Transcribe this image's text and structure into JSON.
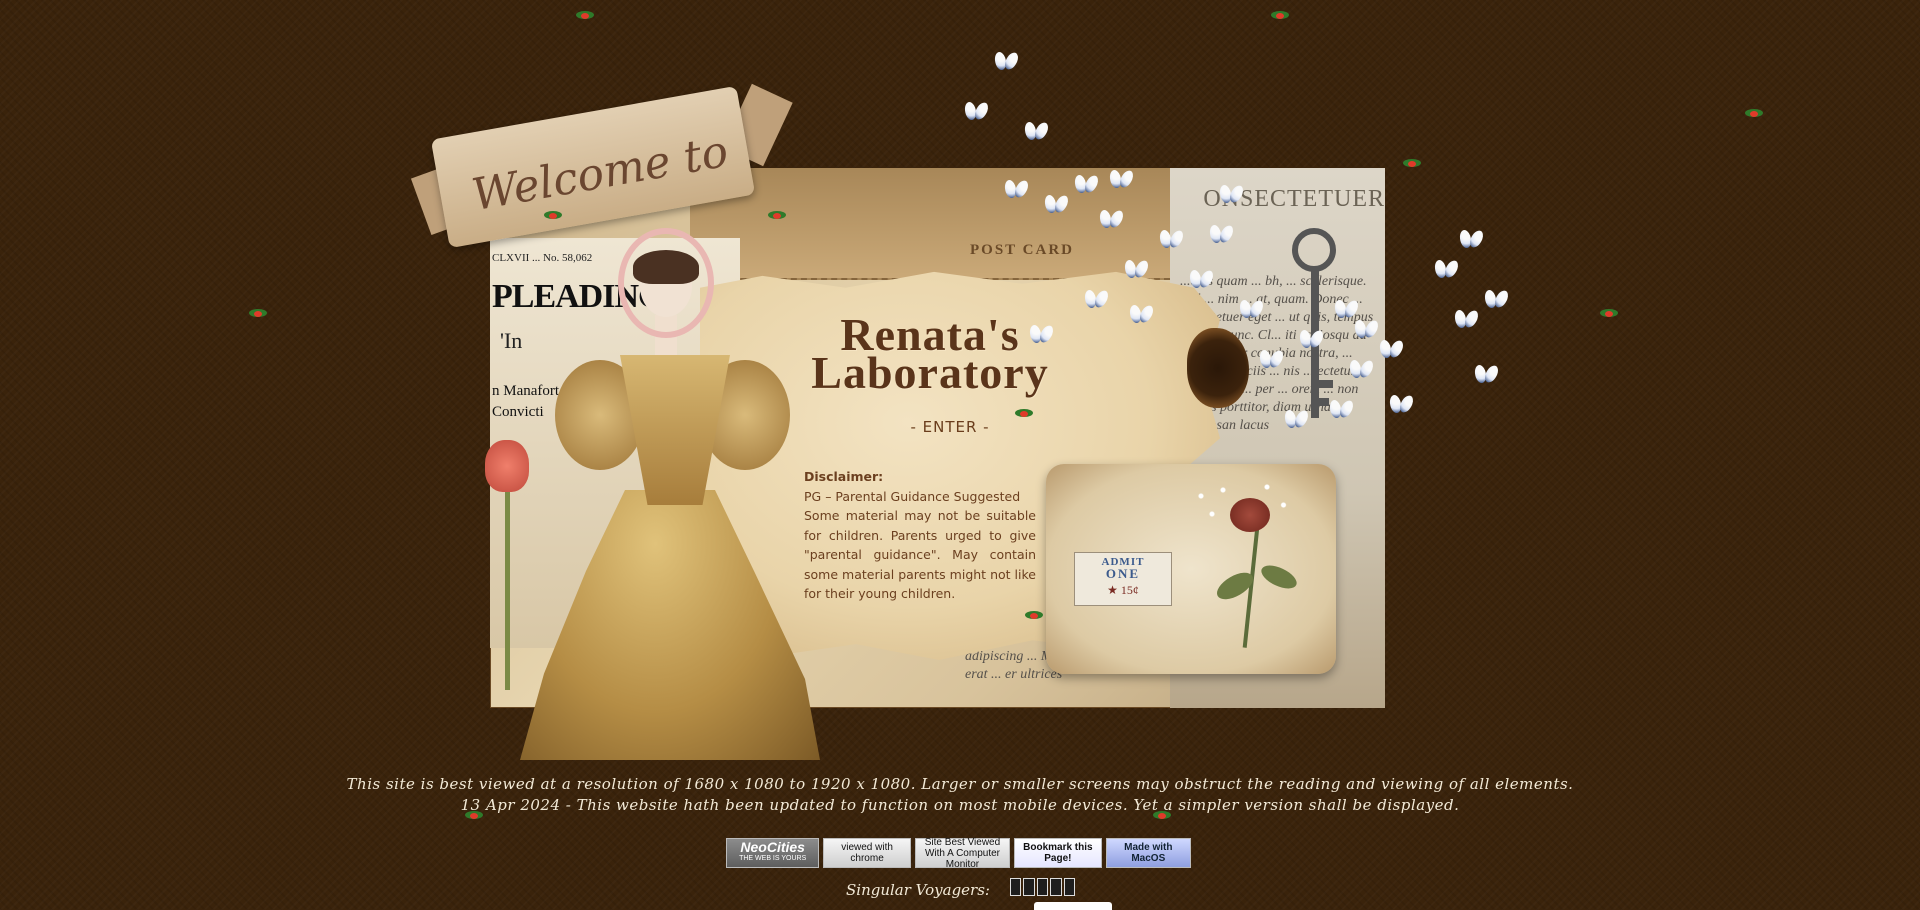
{
  "banner": {
    "text": "Welcome to"
  },
  "newspaper": {
    "masthead": "CLXVII ... No. 58,062",
    "headline": "PLEADING",
    "sub1": "'In",
    "sub2": "n Manafort T",
    "sub3": "Convicti"
  },
  "postcard": {
    "label": "POST CARD"
  },
  "right_column": {
    "heading": "ONSECTETUER",
    "text": "...etus quam ... bh, ... scelerisque. Sed ... nim ... at, quam. Donec ... onsectetuer eget ... ut quis, tempus ... In in nunc. Cl... iti sociosqu ad litora ... per conubia nostra, ... Donec ... sociis ... nis ... ectetur ... ous ... iam ... per ... orem ... non cursus porttitor, diam urna accumsan lacus"
  },
  "bottom_text": "adipiscing ... Morbi neque. Aliquam erat ... er ultrices",
  "site": {
    "title_line1": "Renata's",
    "title_line2": "Laboratory",
    "enter": "- ENTER -"
  },
  "disclaimer": {
    "title": "Disclaimer:",
    "rating": "PG – Parental Guidance Suggested",
    "body": "Some material may not be suitable for children. Parents urged to give \"parental guidance\". May contain some material parents might not like for their young children."
  },
  "ticket": {
    "line1": "ADMIT",
    "line2": "ONE",
    "price": "★ 15¢"
  },
  "footer": {
    "line1": "This site is best viewed at a resolution of 1680 x 1080 to 1920 x 1080. Larger or smaller screens may obstruct the reading and viewing of all elements.",
    "line2": "13 Apr 2024 - This website hath been updated to function on most mobile devices. Yet a simpler version shall be displayed.",
    "voyagers": "Singular Voyagers:"
  },
  "badges": {
    "neocities": "NeoCities",
    "neocities_sub": "THE WEB IS YOURS",
    "chrome": "viewed with chrome",
    "monitor": "Site Best Viewed With A Computer Monitor",
    "bookmark": "Bookmark this Page!",
    "mac": "Made with MacOS"
  },
  "colors": {
    "background": "#3a230b",
    "title": "#5a341a",
    "disclaimer_text": "#6b3f1f",
    "footer_text": "#f3ead7"
  }
}
